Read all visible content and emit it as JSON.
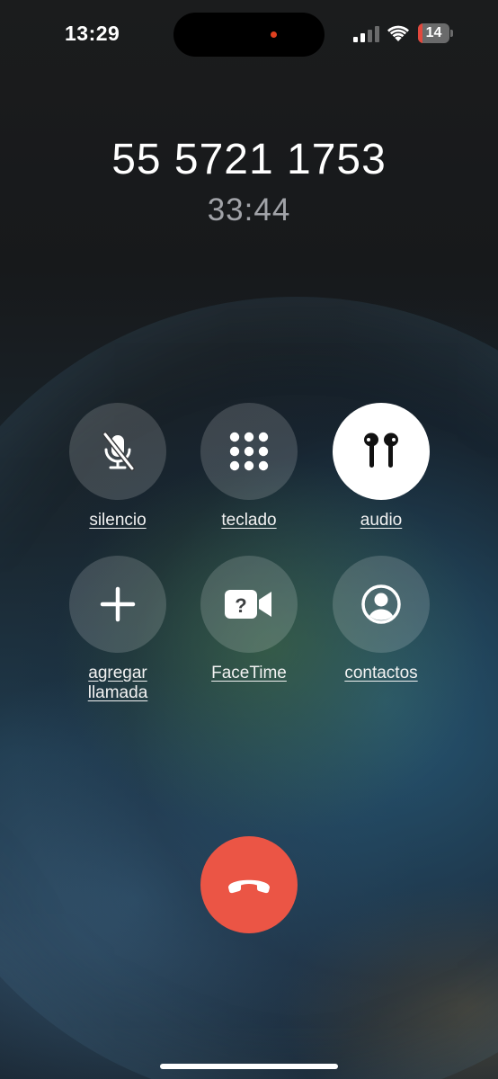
{
  "status_bar": {
    "time": "13:29",
    "battery_level": "14",
    "battery_fraction": 0.14,
    "signal_bars": 2,
    "recording_indicator_color": "#e0401f",
    "battery_color": "#e2483d"
  },
  "call": {
    "number": "55 5721 1753",
    "duration": "33:44"
  },
  "controls": {
    "mute": {
      "label": "silencio",
      "icon": "mic-slash-icon"
    },
    "keypad": {
      "label": "teclado",
      "icon": "keypad-icon"
    },
    "audio": {
      "label": "audio",
      "icon": "airpods-icon",
      "active": true
    },
    "add_call": {
      "label": "agregar\nllamada",
      "icon": "plus-icon"
    },
    "facetime": {
      "label": "FaceTime",
      "icon": "video-question-icon"
    },
    "contacts": {
      "label": "contactos",
      "icon": "person-circle-icon"
    }
  },
  "end_call": {
    "icon": "phone-down-icon",
    "color": "#eb5545"
  }
}
